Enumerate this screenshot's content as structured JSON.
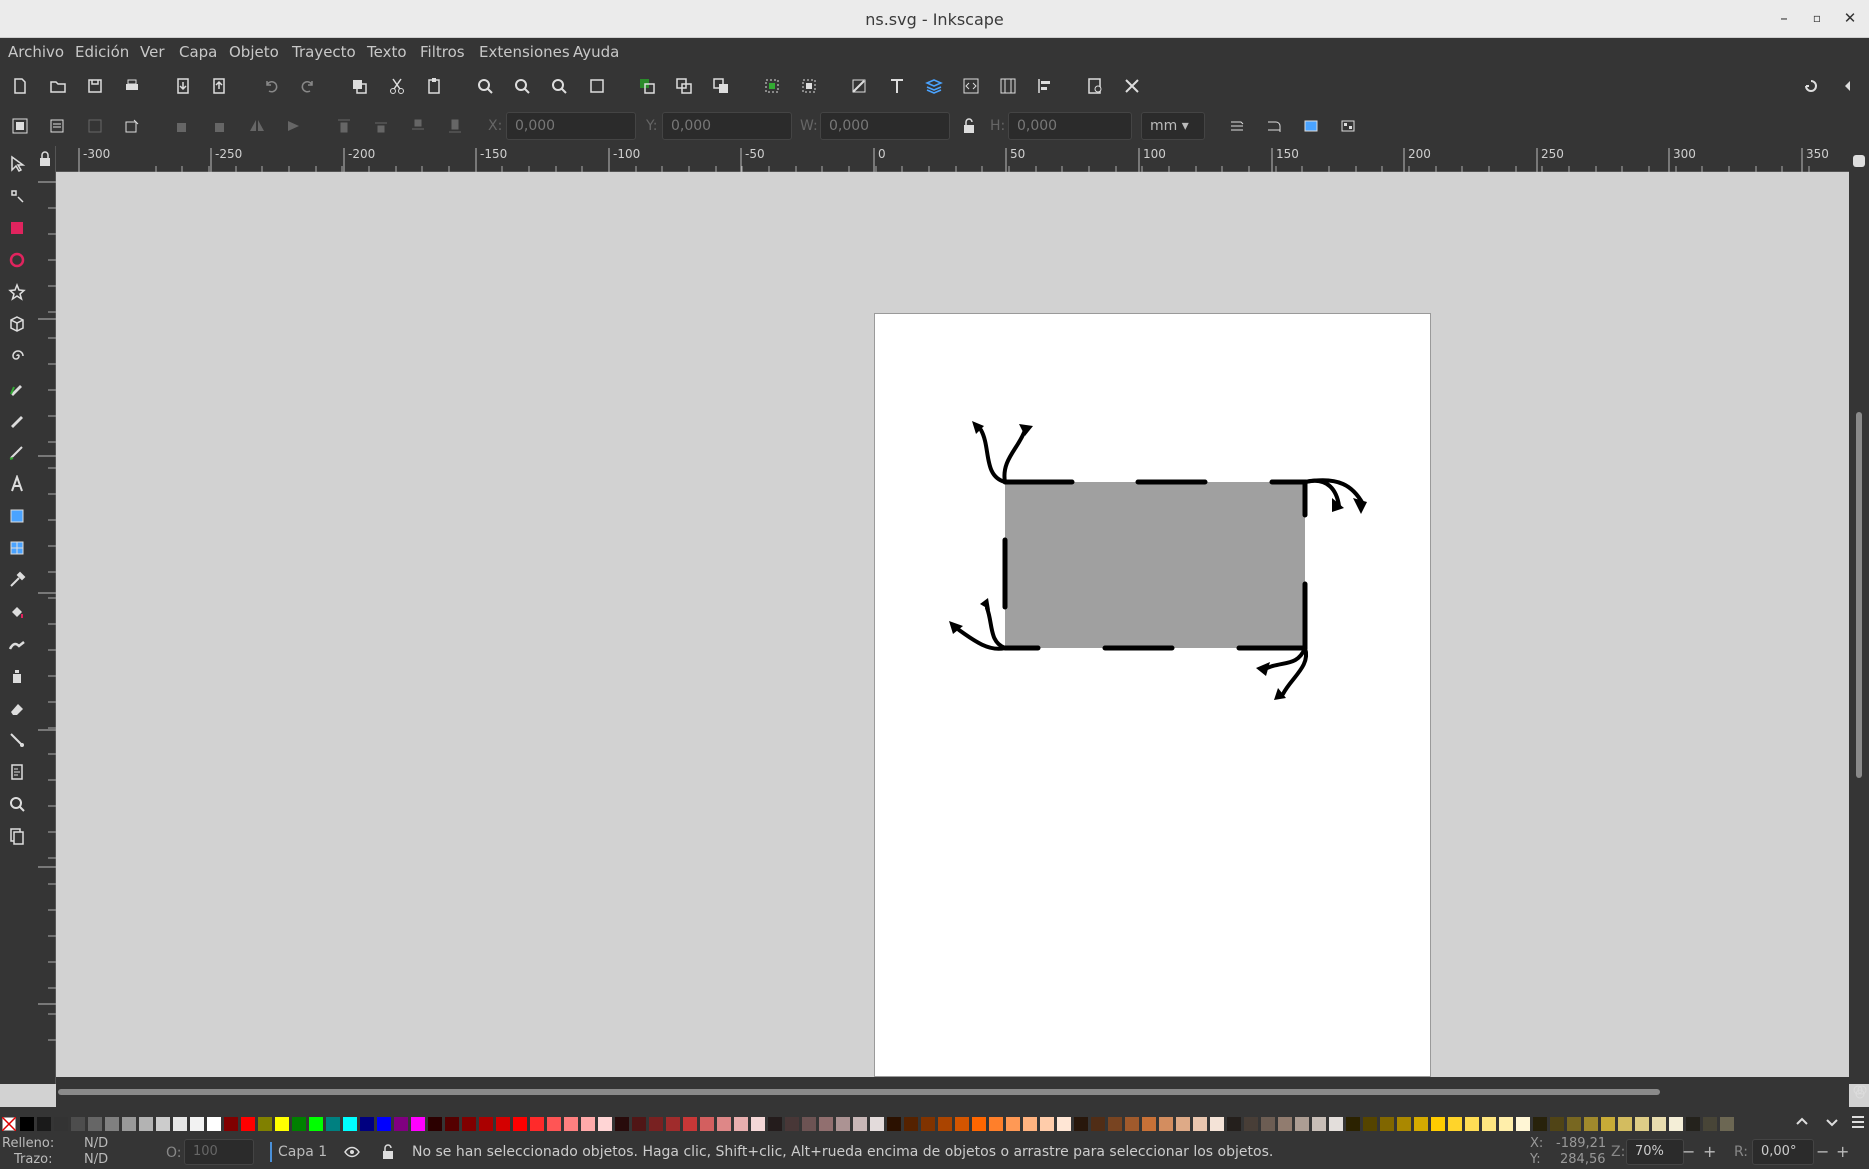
{
  "window": {
    "title": "ns.svg - Inkscape"
  },
  "menu": [
    "Archivo",
    "Edición",
    "Ver",
    "Capa",
    "Objeto",
    "Trayecto",
    "Texto",
    "Filtros",
    "Extensiones",
    "Ayuda"
  ],
  "controls": {
    "x_label": "X:",
    "x_value": "0,000",
    "y_label": "Y:",
    "y_value": "0,000",
    "w_label": "W:",
    "w_value": "0,000",
    "h_label": "H:",
    "h_value": "0,000",
    "unit": "mm"
  },
  "ruler": {
    "h_ticks": [
      "-300",
      "-250",
      "-200",
      "-150",
      "-100",
      "-50",
      "0",
      "50",
      "100",
      "150",
      "200",
      "250",
      "300",
      "350"
    ]
  },
  "canvas": {
    "rect_fill": "#a0a0a0",
    "stroke_color": "#000000",
    "page_color": "#ffffff"
  },
  "palette": [
    "#000000",
    "#1a1a1a",
    "#333333",
    "#4d4d4d",
    "#666666",
    "#808080",
    "#999999",
    "#b3b3b3",
    "#cccccc",
    "#e6e6e6",
    "#f2f2f2",
    "#ffffff",
    "#800000",
    "#ff0000",
    "#808000",
    "#ffff00",
    "#008000",
    "#00ff00",
    "#008080",
    "#00ffff",
    "#000080",
    "#0000ff",
    "#800080",
    "#ff00ff",
    "#2b0000",
    "#550000",
    "#800000",
    "#aa0000",
    "#d40000",
    "#ff0000",
    "#ff2a2a",
    "#ff5555",
    "#ff8080",
    "#ffaaaa",
    "#ffd5d5",
    "#280b0b",
    "#501616",
    "#782121",
    "#a02c2c",
    "#c83737",
    "#d35f5f",
    "#de8787",
    "#e9afaf",
    "#f4d7d7",
    "#241c1c",
    "#483737",
    "#6c5353",
    "#916f6f",
    "#ac9393",
    "#c8b7b7",
    "#e3dbdb",
    "#2b1100",
    "#552200",
    "#803300",
    "#aa4400",
    "#d45500",
    "#ff6600",
    "#ff7f2a",
    "#ff9955",
    "#ffb380",
    "#ffccaa",
    "#ffe6d5",
    "#28170b",
    "#502d16",
    "#784421",
    "#a05a2c",
    "#c87137",
    "#d38d5f",
    "#deaa87",
    "#e9c6af",
    "#f4e3d7",
    "#241f1c",
    "#483e37",
    "#6c5d53",
    "#917c6f",
    "#ac9d93",
    "#c8beb7",
    "#e3dedb",
    "#2b2200",
    "#554400",
    "#806600",
    "#aa8800",
    "#d4aa00",
    "#ffcc00",
    "#ffd42a",
    "#ffdd55",
    "#ffe680",
    "#ffeeaa",
    "#fff6d5",
    "#28220b",
    "#504416",
    "#786721",
    "#a0892c",
    "#c8ab37",
    "#d3bc5f",
    "#decd87",
    "#e9ddaf",
    "#f4eed7",
    "#24221c",
    "#484537",
    "#6c6753"
  ],
  "status": {
    "fill_label": "Relleno:",
    "fill_value": "N/D",
    "stroke_label": "Trazo:",
    "stroke_value": "N/D",
    "opacity_label": "O:",
    "opacity_value": "100",
    "layer": "Capa 1",
    "message": "No se han seleccionado objetos. Haga clic, Shift+clic, Alt+rueda encima de objetos o arrastre para seleccionar los objetos.",
    "x_label": "X:",
    "x_value": "-189,21",
    "y_label": "Y:",
    "y_value": "284,56",
    "zoom_label": "Z:",
    "zoom_value": "70%",
    "rotation_label": "R:",
    "rotation_value": "0,00°"
  }
}
